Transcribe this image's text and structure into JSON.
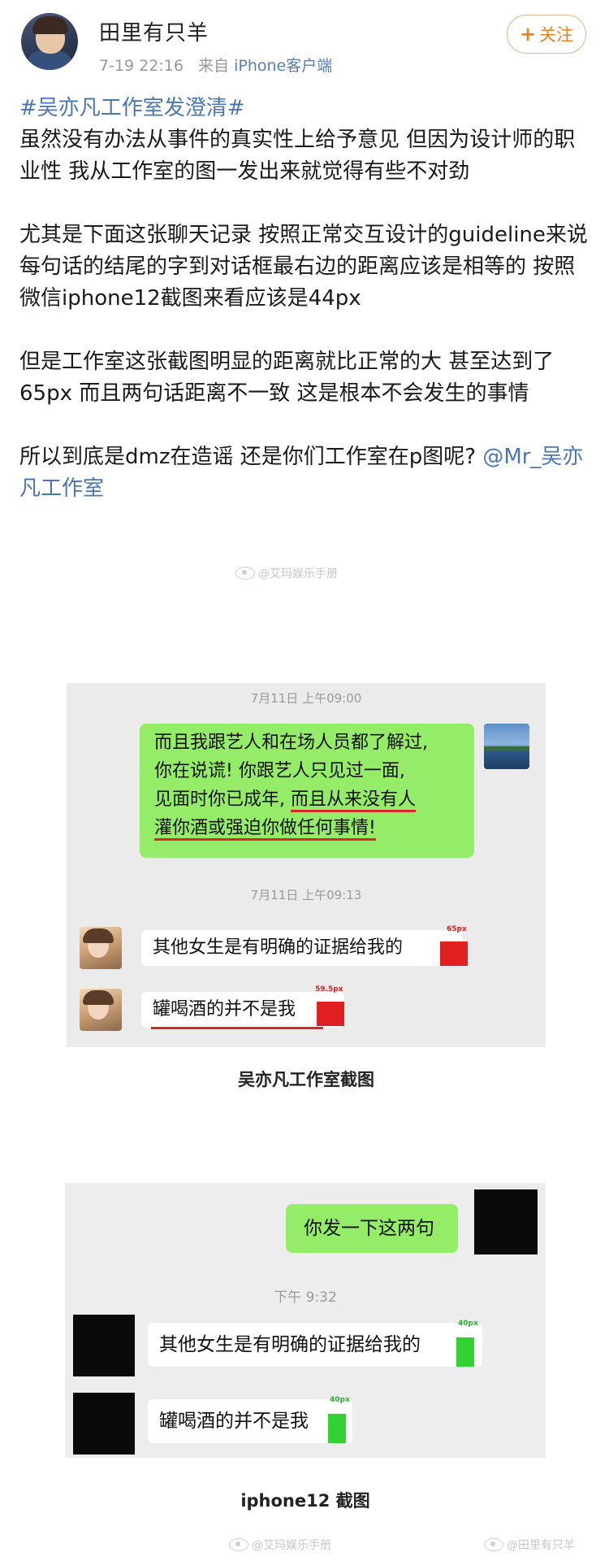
{
  "header": {
    "username": "田里有只羊",
    "date": "7-19 22:16",
    "source_prefix": "来自",
    "device": "iPhone客户端",
    "follow_label": "关注",
    "follow_icon": "plus-icon"
  },
  "post": {
    "hashtag": "#吴亦凡工作室发澄清#",
    "para1": "虽然没有办法从事件的真实性上给予意见 但因为设计师的职业性 我从工作室的图一发出来就觉得有些不对劲",
    "para2": "尤其是下面这张聊天记录 按照正常交互设计的guideline来说 每句话的结尾的字到对话框最右边的距离应该是相等的 按照微信iphone12截图来看应该是44px",
    "para3": "但是工作室这张截图明显的距离就比正常的大 甚至达到了65px 而且两句话距离不一致 这是根本不会发生的事情",
    "para4_text": "所以到底是dmz在造谣 还是你们工作室在p图呢? ",
    "mention": "@Mr_吴亦凡工作室",
    "watermark1": "@艾玛娱乐手册"
  },
  "shot1": {
    "stamp1": "7月11日 上午09:00",
    "green_line1": "而且我跟艺人和在场人员都了解过,",
    "green_line2": "你在说谎! 你跟艺人只见过一面,",
    "green_line3a": "见面时你已成年, ",
    "green_line3b": "而且从来没有人",
    "green_line4": "灌你酒或强迫你做任何事情!",
    "stamp2": "7月11日 上午09:13",
    "msg1": "其他女生是有明确的证据给我的",
    "msg1_px": "65px",
    "msg2": "罐喝酒的并不是我",
    "msg2_px": "59.5px",
    "caption": "吴亦凡工作室截图"
  },
  "shot2": {
    "green_msg": "你发一下这两句",
    "stamp": "下午 9:32",
    "msg1": "其他女生是有明确的证据给我的",
    "msg1_px": "40px",
    "msg2": "罐喝酒的并不是我",
    "msg2_px": "40px",
    "caption": "iphone12 截图",
    "watermark_left": "@艾玛娱乐手册",
    "watermark_right": "@田里有只羊"
  },
  "colors": {
    "link": "#4a77b4",
    "follow": "#e8811e",
    "wechat_green": "#95ec69",
    "mark_red": "#e02020",
    "mark_green": "#33d233"
  }
}
